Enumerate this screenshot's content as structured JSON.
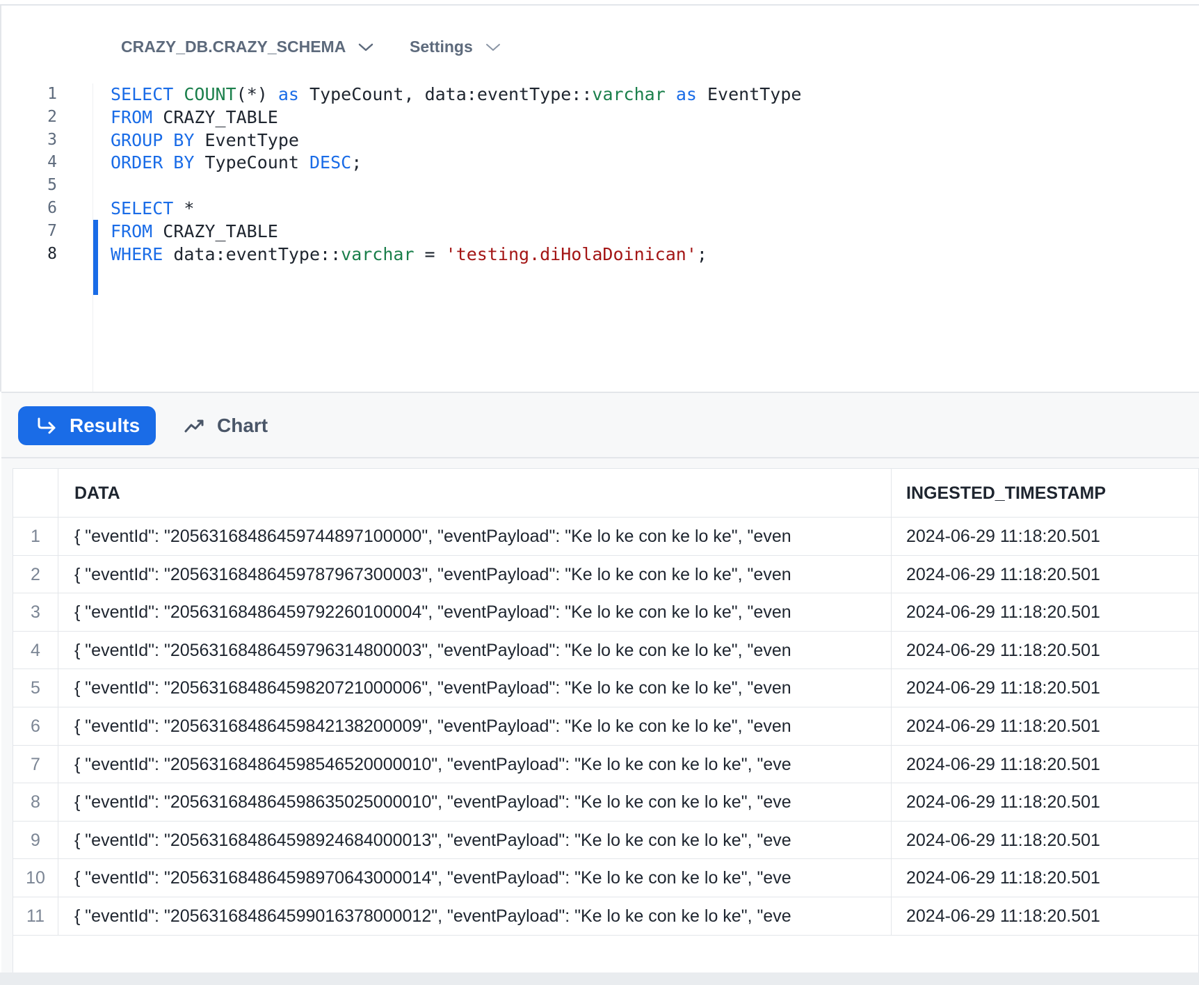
{
  "context": {
    "database_schema": "CRAZY_DB.CRAZY_SCHEMA",
    "settings_label": "Settings"
  },
  "editor": {
    "line_numbers": [
      "1",
      "2",
      "3",
      "4",
      "5",
      "6",
      "7",
      "8"
    ],
    "active_line": 8,
    "selected_lines": [
      6,
      7,
      8
    ],
    "lines": [
      [
        [
          "kw",
          "SELECT"
        ],
        [
          "t",
          " "
        ],
        [
          "fn",
          "COUNT"
        ],
        [
          "t",
          "(*) "
        ],
        [
          "kw",
          "as"
        ],
        [
          "t",
          " TypeCount, data:eventType::"
        ],
        [
          "fn",
          "varchar"
        ],
        [
          "t",
          " "
        ],
        [
          "kw",
          "as"
        ],
        [
          "t",
          " EventType"
        ]
      ],
      [
        [
          "kw",
          "FROM"
        ],
        [
          "t",
          " CRAZY_TABLE"
        ]
      ],
      [
        [
          "kw",
          "GROUP BY"
        ],
        [
          "t",
          " EventType"
        ]
      ],
      [
        [
          "kw",
          "ORDER BY"
        ],
        [
          "t",
          " TypeCount "
        ],
        [
          "kw",
          "DESC"
        ],
        [
          "t",
          ";"
        ]
      ],
      [],
      [
        [
          "kw",
          "SELECT"
        ],
        [
          "t",
          " *"
        ]
      ],
      [
        [
          "kw",
          "FROM"
        ],
        [
          "t",
          " CRAZY_TABLE"
        ]
      ],
      [
        [
          "kw",
          "WHERE"
        ],
        [
          "t",
          " data:eventType::"
        ],
        [
          "fn",
          "varchar"
        ],
        [
          "t",
          " = "
        ],
        [
          "str",
          "'testing.diHolaDoinican'"
        ],
        [
          "t",
          ";"
        ]
      ]
    ]
  },
  "tabs": {
    "results_label": "Results",
    "chart_label": "Chart",
    "active": "Results"
  },
  "results": {
    "columns": [
      "DATA",
      "INGESTED_TIMESTAMP"
    ],
    "rows": [
      {
        "idx": "1",
        "data": "{  \"eventId\": \"20563168486459744897100000\",  \"eventPayload\": \"Ke lo ke con ke lo ke\",  \"even",
        "ts": "2024-06-29 11:18:20.501"
      },
      {
        "idx": "2",
        "data": "{  \"eventId\": \"20563168486459787967300003\",  \"eventPayload\": \"Ke lo ke con ke lo ke\",  \"even",
        "ts": "2024-06-29 11:18:20.501"
      },
      {
        "idx": "3",
        "data": "{  \"eventId\": \"20563168486459792260100004\",  \"eventPayload\": \"Ke lo ke con ke lo ke\",  \"even",
        "ts": "2024-06-29 11:18:20.501"
      },
      {
        "idx": "4",
        "data": "{  \"eventId\": \"20563168486459796314800003\",  \"eventPayload\": \"Ke lo ke con ke lo ke\",  \"even",
        "ts": "2024-06-29 11:18:20.501"
      },
      {
        "idx": "5",
        "data": "{  \"eventId\": \"20563168486459820721000006\",  \"eventPayload\": \"Ke lo ke con ke lo ke\",  \"even",
        "ts": "2024-06-29 11:18:20.501"
      },
      {
        "idx": "6",
        "data": "{  \"eventId\": \"20563168486459842138200009\",  \"eventPayload\": \"Ke lo ke con ke lo ke\",  \"even",
        "ts": "2024-06-29 11:18:20.501"
      },
      {
        "idx": "7",
        "data": "{  \"eventId\": \"205631684864598546520000010\",  \"eventPayload\": \"Ke lo ke con ke lo ke\",  \"eve",
        "ts": "2024-06-29 11:18:20.501"
      },
      {
        "idx": "8",
        "data": "{  \"eventId\": \"205631684864598635025000010\",  \"eventPayload\": \"Ke lo ke con ke lo ke\",  \"eve",
        "ts": "2024-06-29 11:18:20.501"
      },
      {
        "idx": "9",
        "data": "{  \"eventId\": \"205631684864598924684000013\",  \"eventPayload\": \"Ke lo ke con ke lo ke\",  \"eve",
        "ts": "2024-06-29 11:18:20.501"
      },
      {
        "idx": "10",
        "data": "{  \"eventId\": \"205631684864598970643000014\",  \"eventPayload\": \"Ke lo ke con ke lo ke\",  \"eve",
        "ts": "2024-06-29 11:18:20.501"
      },
      {
        "idx": "11",
        "data": "{  \"eventId\": \"205631684864599016378000012\",  \"eventPayload\": \"Ke lo ke con ke lo ke\",  \"eve",
        "ts": "2024-06-29 11:18:20.501"
      }
    ]
  }
}
